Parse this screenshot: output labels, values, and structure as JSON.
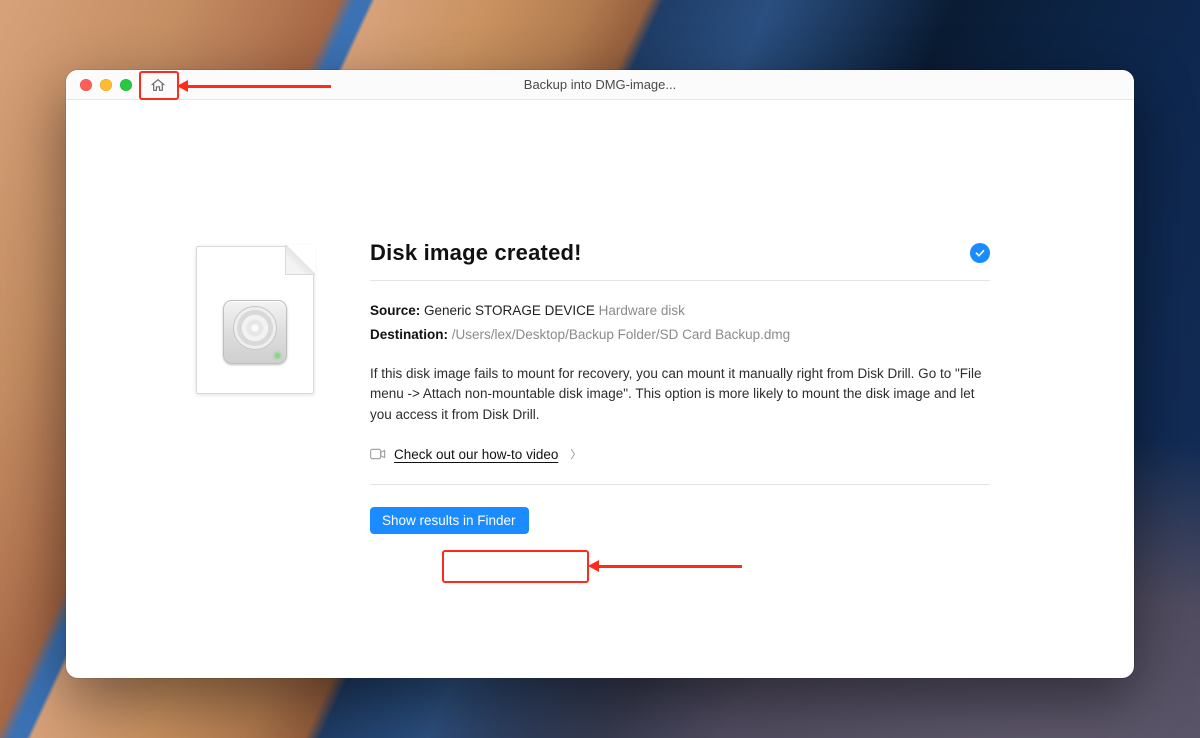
{
  "window": {
    "title": "Backup into DMG-image..."
  },
  "panel": {
    "heading": "Disk image created!",
    "source_label": "Source:",
    "source_value": "Generic STORAGE DEVICE",
    "source_suffix": "Hardware disk",
    "destination_label": "Destination:",
    "destination_value": "/Users/lex/Desktop/Backup Folder/SD Card Backup.dmg",
    "help_text": "If this disk image fails to mount for recovery, you can mount it manually right from Disk Drill. Go to \"File menu -> Attach non-mountable disk image\". This option is more likely to mount the disk image and let you access it from Disk Drill.",
    "video_link_label": "Check out our how-to video",
    "primary_button_label": "Show results in Finder"
  }
}
